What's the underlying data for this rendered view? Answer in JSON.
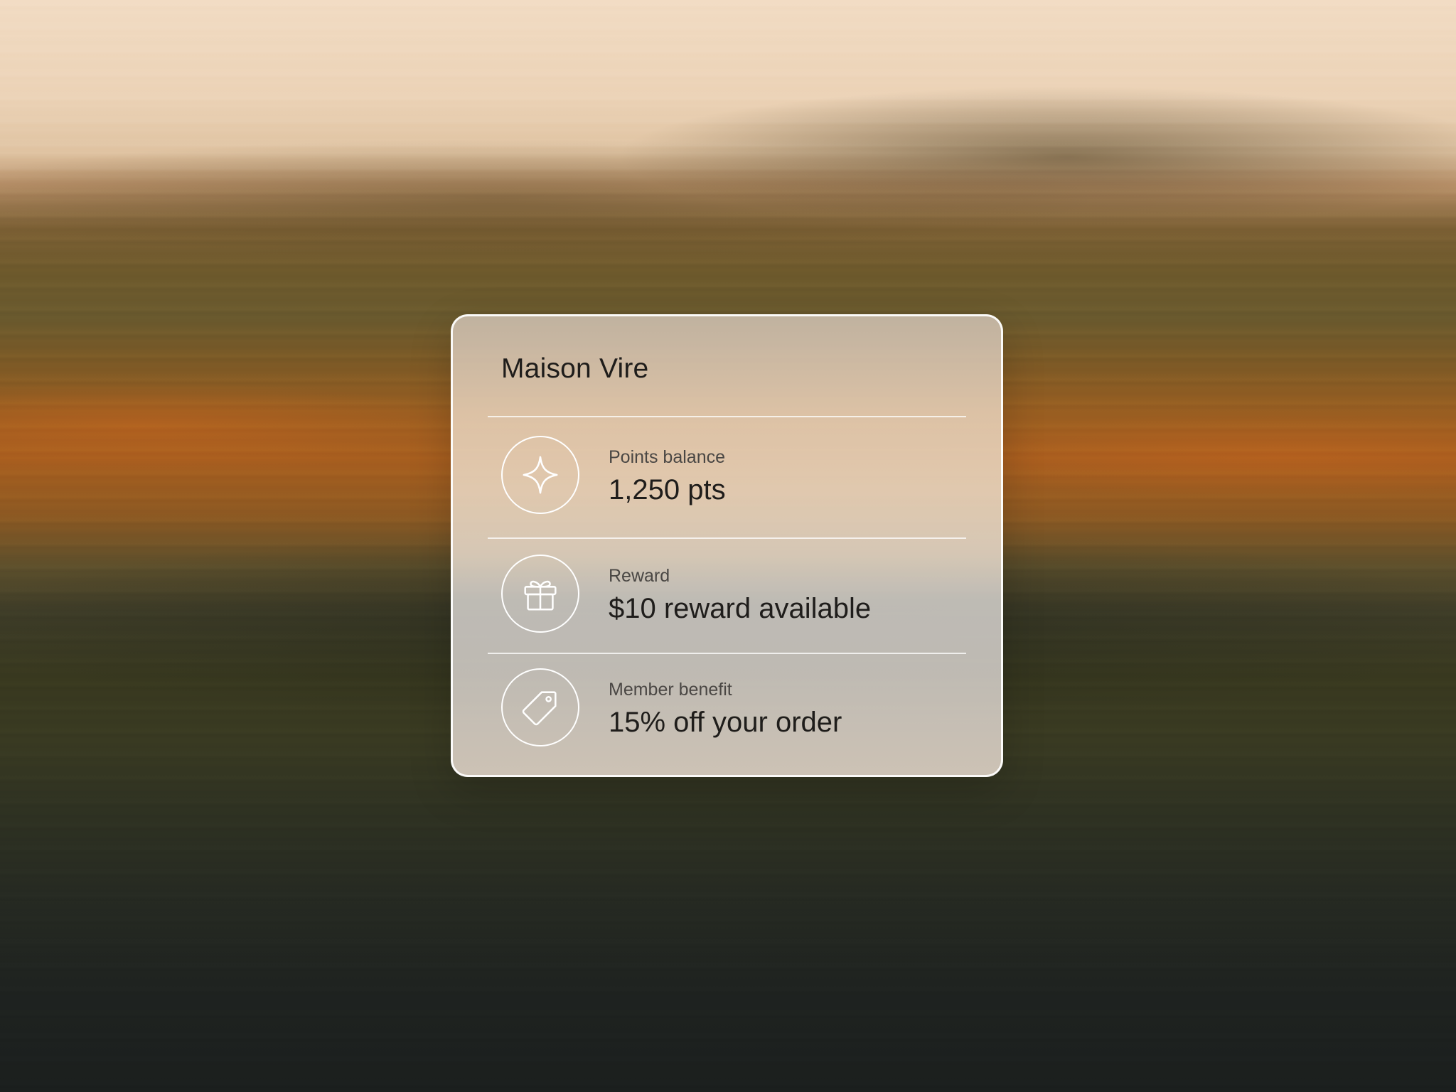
{
  "card": {
    "brand_name": "Maison Vire",
    "rows": [
      {
        "icon": "sparkle-icon",
        "label": "Points balance",
        "value": "1,250 pts"
      },
      {
        "icon": "gift-icon",
        "label": "Reward",
        "value": "$10 reward available"
      },
      {
        "icon": "tag-icon",
        "label": "Member benefit",
        "value": "15% off your order"
      }
    ]
  },
  "colors": {
    "text_primary": "#1f1d1b",
    "text_secondary": "#4a4744",
    "card_border": "#ffffff",
    "background_top": "#f2dcc4",
    "background_mid": "#a85f1f",
    "background_bottom": "#1b1f1e"
  }
}
